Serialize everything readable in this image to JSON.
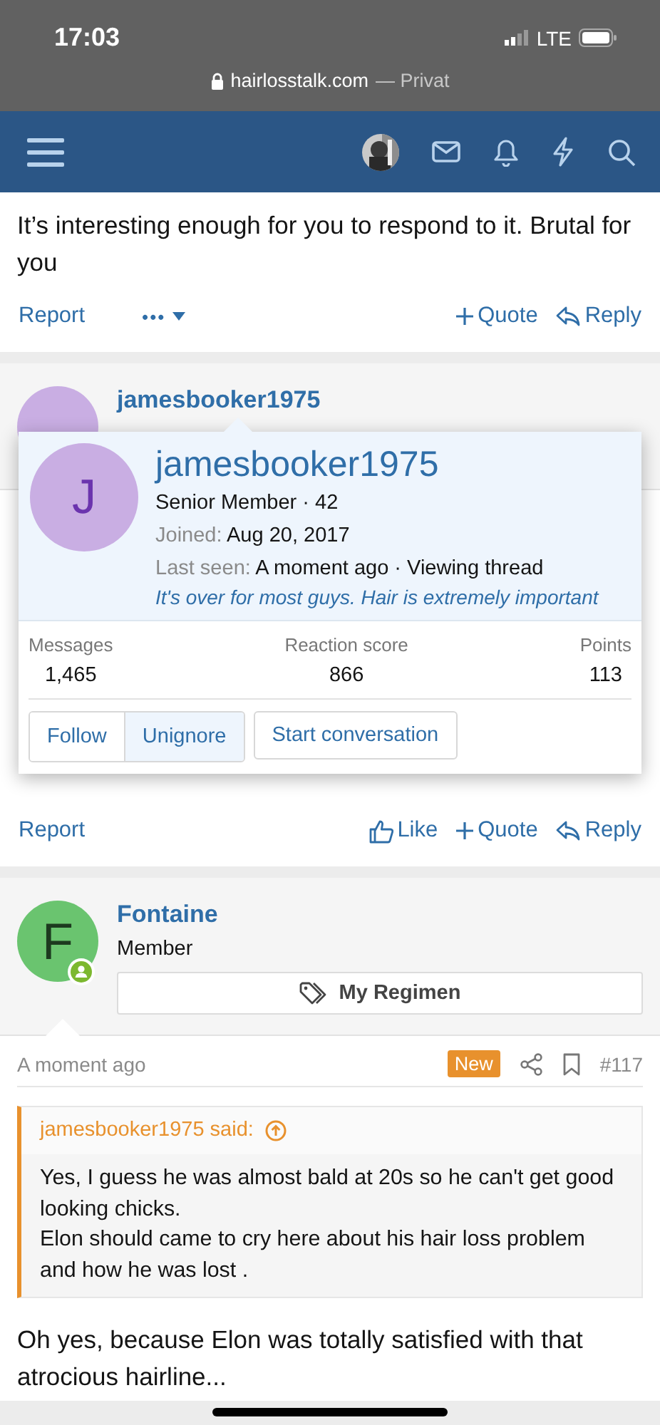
{
  "status_bar": {
    "time": "17:03",
    "network": "LTE",
    "url": "hairlosstalk.com",
    "url_suffix": "— Privat"
  },
  "posts": [
    {
      "kind": "text",
      "body": "It’s interesting enough for you to respond to it. Brutal for you",
      "actions": [
        {
          "kind": "link",
          "label": "Report"
        },
        {
          "kind": "more",
          "label": "•••"
        },
        {
          "kind": "quote",
          "label": "Quote"
        },
        {
          "kind": "reply",
          "label": "Reply"
        }
      ]
    },
    {
      "kind": "hovered",
      "author": {
        "name": "jamesbooker1975",
        "color": "#c9aee3"
      },
      "actions": [
        {
          "kind": "link",
          "label": "Report"
        },
        {
          "kind": "like",
          "label": "Like"
        },
        {
          "kind": "quote",
          "label": "Quote"
        },
        {
          "kind": "reply",
          "label": "Reply"
        }
      ]
    },
    {
      "kind": "full",
      "author": {
        "initial": "F",
        "name": "Fontaine",
        "title": "Member",
        "color": "#6ac46f",
        "online": true
      },
      "banner": "My Regimen",
      "time": "A moment ago",
      "badge": "New",
      "number": "#117",
      "quote": {
        "author": "jamesbooker1975 said:",
        "lines": [
          "Yes, I guess he was almost bald at 20s so he can't get good looking chicks.",
          "Elon should came to cry here about his hair loss problem and how he was lost ."
        ]
      },
      "body": "Oh yes, because Elon was totally satisfied with that atrocious hairline..."
    }
  ],
  "popup": {
    "initial": "J",
    "name": "jamesbooker1975",
    "title": "Senior Member · 42",
    "joined_label": "Joined:",
    "joined": "Aug 20, 2017",
    "last_seen_label": "Last seen:",
    "last_seen": "A moment ago · Viewing thread",
    "thread": "It's over for most guys. Hair is extremely important",
    "stats": [
      {
        "label": "Messages",
        "value": "1,465"
      },
      {
        "label": "Reaction score",
        "value": "866"
      },
      {
        "label": "Points",
        "value": "113"
      }
    ],
    "buttons": [
      {
        "label": "Follow",
        "selected": false
      },
      {
        "label": "Unignore",
        "selected": true
      },
      {
        "label": "Start conversation",
        "selected": false
      }
    ]
  }
}
